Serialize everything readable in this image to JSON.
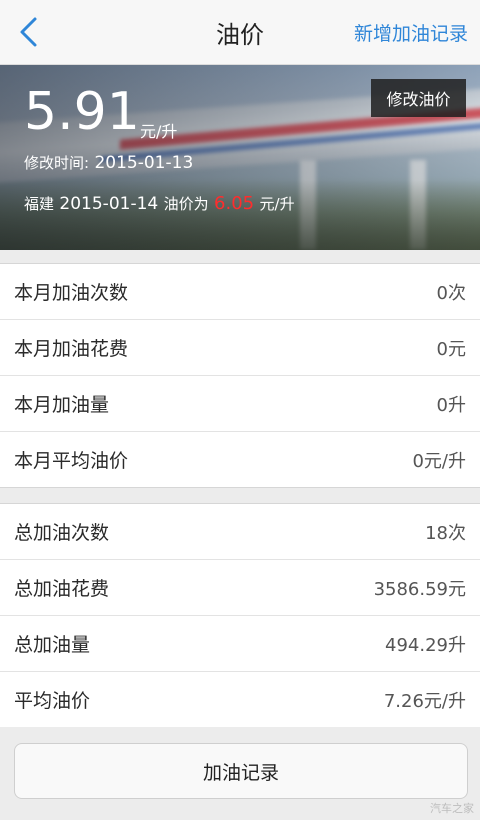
{
  "header": {
    "title": "油价",
    "add_record_label": "新增加油记录"
  },
  "hero": {
    "price": "5.91",
    "price_unit": "元/升",
    "modified_label": "修改时间:",
    "modified_date": "2015-01-13",
    "region": "福建",
    "region_date": "2015-01-14",
    "region_price_label": "油价为",
    "region_price": "6.05",
    "region_unit": "元/升",
    "edit_price_label": "修改油价",
    "highlight_color": "#ff2d2d"
  },
  "monthly": [
    {
      "label": "本月加油次数",
      "value": "0次"
    },
    {
      "label": "本月加油花费",
      "value": "0元"
    },
    {
      "label": "本月加油量",
      "value": "0升"
    },
    {
      "label": "本月平均油价",
      "value": "0元/升"
    }
  ],
  "totals": [
    {
      "label": "总加油次数",
      "value": "18次"
    },
    {
      "label": "总加油花费",
      "value": "3586.59元"
    },
    {
      "label": "总加油量",
      "value": "494.29升"
    },
    {
      "label": "平均油价",
      "value": "7.26元/升"
    }
  ],
  "records_button_label": "加油记录",
  "watermark": "汽车之家",
  "accent_color": "#2f86d8"
}
